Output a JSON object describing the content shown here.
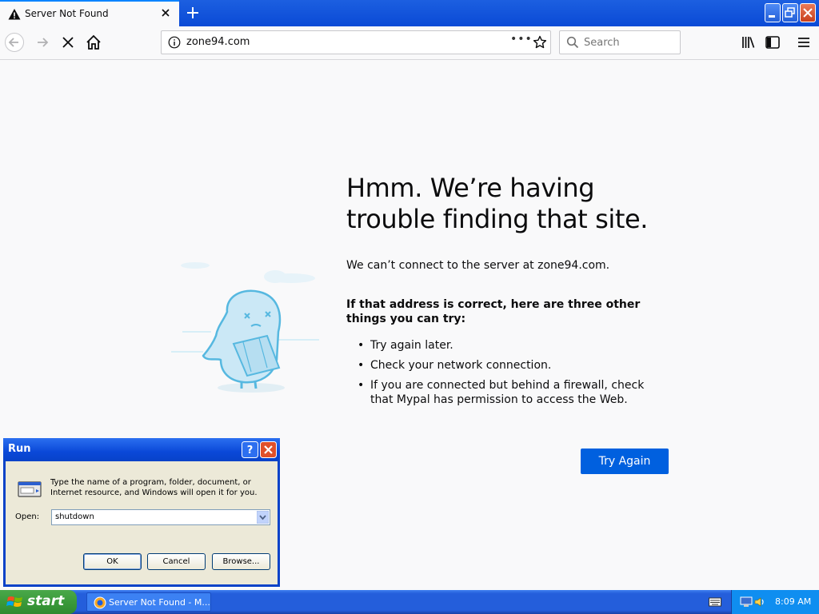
{
  "browser": {
    "tab_title": "Server Not Found",
    "url": "zone94.com",
    "search_placeholder": "Search",
    "url_menu_glyph": "•••"
  },
  "error_page": {
    "title": "Hmm. We’re having trouble finding that site.",
    "description": "We can’t connect to the server at zone94.com.",
    "suggestions_heading": "If that address is correct, here are three other things you can try:",
    "suggestions": [
      "Try again later.",
      "Check your network connection.",
      "If you are connected but behind a firewall, check that Mypal has permission to access the Web."
    ],
    "try_again_label": "Try Again"
  },
  "run_dialog": {
    "title": "Run",
    "help_glyph": "?",
    "description": "Type the name of a program, folder, document, or Internet resource, and Windows will open it for you.",
    "open_label": "Open:",
    "open_value": "shutdown",
    "ok_label": "OK",
    "cancel_label": "Cancel",
    "browse_label": "Browse..."
  },
  "taskbar": {
    "start_label": "start",
    "task_label": "Server Not Found - M...",
    "clock": "8:09 AM"
  },
  "colors": {
    "accent": "#0060df",
    "xp_blue": "#245edb",
    "start_green": "#3a9a3a"
  },
  "icons": [
    "warning-icon",
    "tab-close-icon",
    "new-tab-icon",
    "back-arrow-icon",
    "forward-arrow-icon",
    "stop-icon",
    "home-icon",
    "info-icon",
    "bookmark-star-icon",
    "search-icon",
    "library-icon",
    "sidebar-icon",
    "menu-icon",
    "help-icon",
    "close-icon",
    "run-program-icon",
    "dropdown-arrow-icon",
    "windows-flag-icon",
    "keyboard-icon",
    "network-icon",
    "speaker-icon"
  ]
}
